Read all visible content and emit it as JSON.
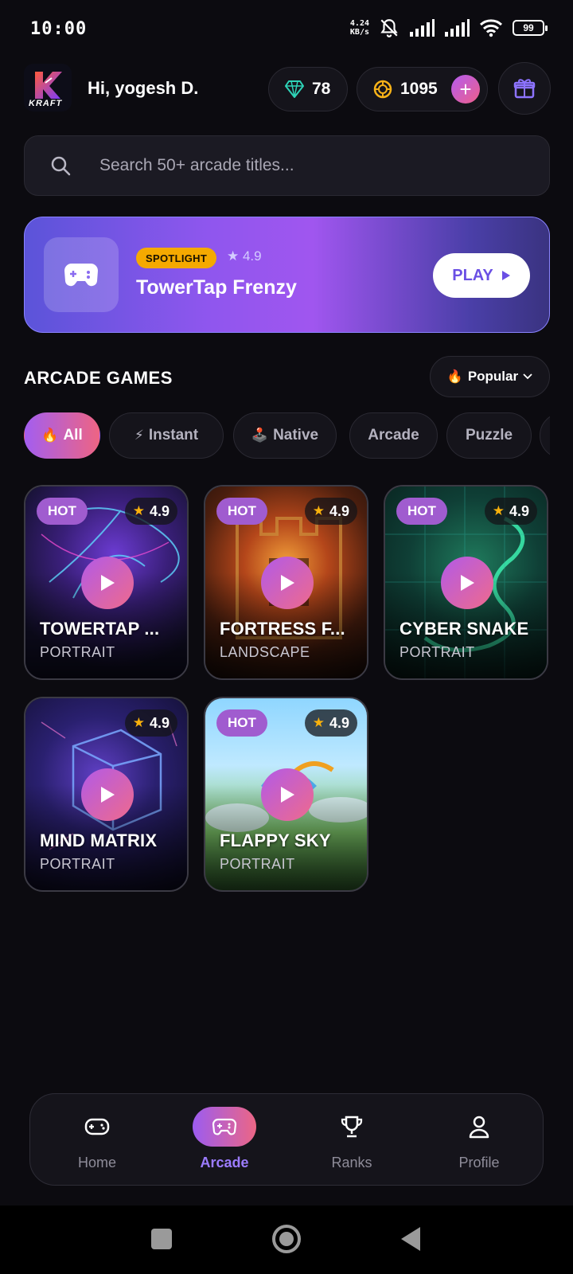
{
  "status_bar": {
    "time": "10:00",
    "net_speed_value": "4.24",
    "net_speed_unit": "KB/s",
    "battery": "99",
    "icons": [
      "mute-bell-icon",
      "signal-icon",
      "signal-icon",
      "wifi-icon",
      "battery-icon"
    ]
  },
  "header": {
    "logo_text": "KRAFT",
    "greeting": "Hi, yogesh D.",
    "gems": "78",
    "coins": "1095",
    "add_label": "+",
    "icons": {
      "gems": "diamond-icon",
      "coins": "coin-icon",
      "gift": "gift-icon"
    }
  },
  "search": {
    "placeholder": "Search 50+ arcade titles..."
  },
  "spotlight": {
    "badge": "SPOTLIGHT",
    "rating": "★ 4.9",
    "title": "TowerTap Frenzy",
    "play_label": "PLAY",
    "icon": "gamepad-icon"
  },
  "section": {
    "title": "ARCADE GAMES",
    "sort_label": "Popular"
  },
  "chips": [
    {
      "label": "All",
      "emoji": "🔥",
      "active": true
    },
    {
      "label": "Instant",
      "emoji": "⚡",
      "active": false
    },
    {
      "label": "Native",
      "emoji": "🕹️",
      "active": false
    },
    {
      "label": "Arcade",
      "emoji": "",
      "active": false
    },
    {
      "label": "Puzzle",
      "emoji": "",
      "active": false
    }
  ],
  "games": [
    {
      "title": "TOWERTAP ...",
      "orientation": "PORTRAIT",
      "rating": "4.9",
      "hot": "HOT"
    },
    {
      "title": "FORTRESS F...",
      "orientation": "LANDSCAPE",
      "rating": "4.9",
      "hot": "HOT"
    },
    {
      "title": "CYBER SNAKE",
      "orientation": "PORTRAIT",
      "rating": "4.9",
      "hot": "HOT"
    },
    {
      "title": "MIND MATRIX",
      "orientation": "PORTRAIT",
      "rating": "4.9",
      "hot": ""
    },
    {
      "title": "FLAPPY SKY",
      "orientation": "PORTRAIT",
      "rating": "4.9",
      "hot": "HOT"
    }
  ],
  "bottom_nav": [
    {
      "label": "Home",
      "icon": "gamepad-icon",
      "active": false
    },
    {
      "label": "Arcade",
      "icon": "gamepad-icon",
      "active": true
    },
    {
      "label": "Ranks",
      "icon": "trophy-icon",
      "active": false
    },
    {
      "label": "Profile",
      "icon": "user-icon",
      "active": false
    }
  ],
  "colors": {
    "background": "#0c0b10",
    "accent_purple": "#9c5cf0",
    "accent_pink": "#ec6685",
    "spotlight_badge": "#f5a900",
    "star": "#f8b10c"
  }
}
